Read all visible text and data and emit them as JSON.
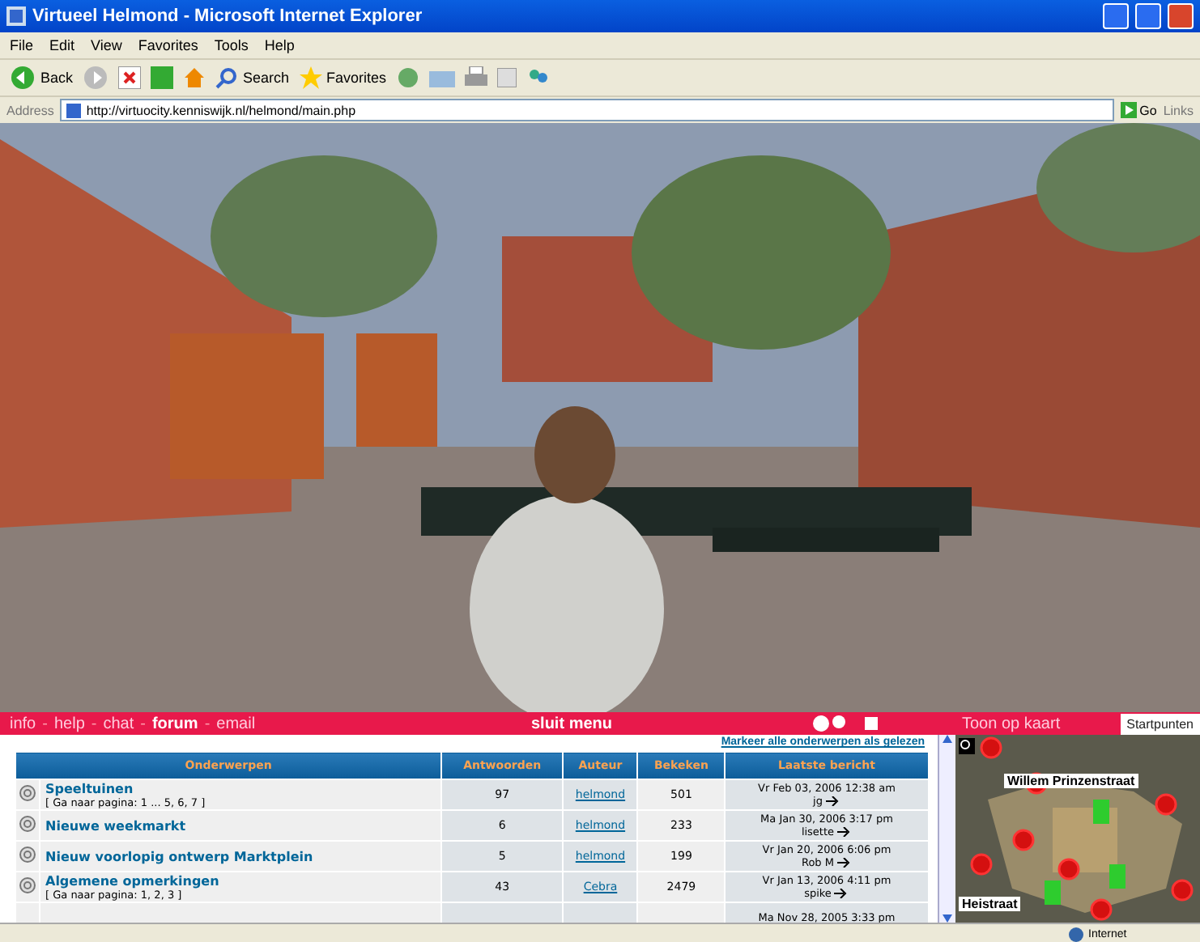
{
  "window": {
    "title": "Virtueel Helmond - Microsoft Internet Explorer"
  },
  "menu": [
    "File",
    "Edit",
    "View",
    "Favorites",
    "Tools",
    "Help"
  ],
  "toolbar": {
    "back": "Back",
    "search": "Search",
    "favorites": "Favorites"
  },
  "address": {
    "label": "Address",
    "url": "http://virtuocity.kenniswijk.nl/helmond/main.php",
    "go": "Go",
    "links": "Links"
  },
  "nav": {
    "items": [
      {
        "label": "info",
        "selected": false
      },
      {
        "label": "help",
        "selected": false
      },
      {
        "label": "chat",
        "selected": false
      },
      {
        "label": "forum",
        "selected": true
      },
      {
        "label": "email",
        "selected": false
      }
    ],
    "separator": "-",
    "close": "sluit menu"
  },
  "map_panel": {
    "title": "Toon op kaart",
    "button": "Startpunten",
    "labels": [
      "Willem Prinzenstraat",
      "Heistraat"
    ]
  },
  "forum": {
    "mark_all": "Markeer alle onderwerpen als gelezen",
    "columns": [
      "Onderwerpen",
      "Antwoorden",
      "Auteur",
      "Bekeken",
      "Laatste bericht"
    ],
    "rows": [
      {
        "topic": "Speeltuinen",
        "pages": "[ Ga naar pagina: 1 ... 5, 6, 7 ]",
        "replies": "97",
        "author": "helmond",
        "views": "501",
        "last_date": "Vr Feb 03, 2006 12:38 am",
        "last_user": "jg"
      },
      {
        "topic": "Nieuwe weekmarkt",
        "replies": "6",
        "author": "helmond",
        "views": "233",
        "last_date": "Ma Jan 30, 2006 3:17 pm",
        "last_user": "lisette"
      },
      {
        "topic": "Nieuw voorlopig ontwerp Marktplein",
        "replies": "5",
        "author": "helmond",
        "views": "199",
        "last_date": "Vr Jan 20, 2006 6:06 pm",
        "last_user": "Rob M"
      },
      {
        "topic": "Algemene opmerkingen",
        "pages": "[ Ga naar pagina: 1, 2, 3 ]",
        "replies": "43",
        "author": "Cebra",
        "views": "2479",
        "last_date": "Vr Jan 13, 2006 4:11 pm",
        "last_user": "spike"
      }
    ],
    "partial_row": {
      "last_date": "Ma Nov 28, 2005 3:33 pm"
    }
  },
  "status": {
    "zone": "Internet"
  }
}
